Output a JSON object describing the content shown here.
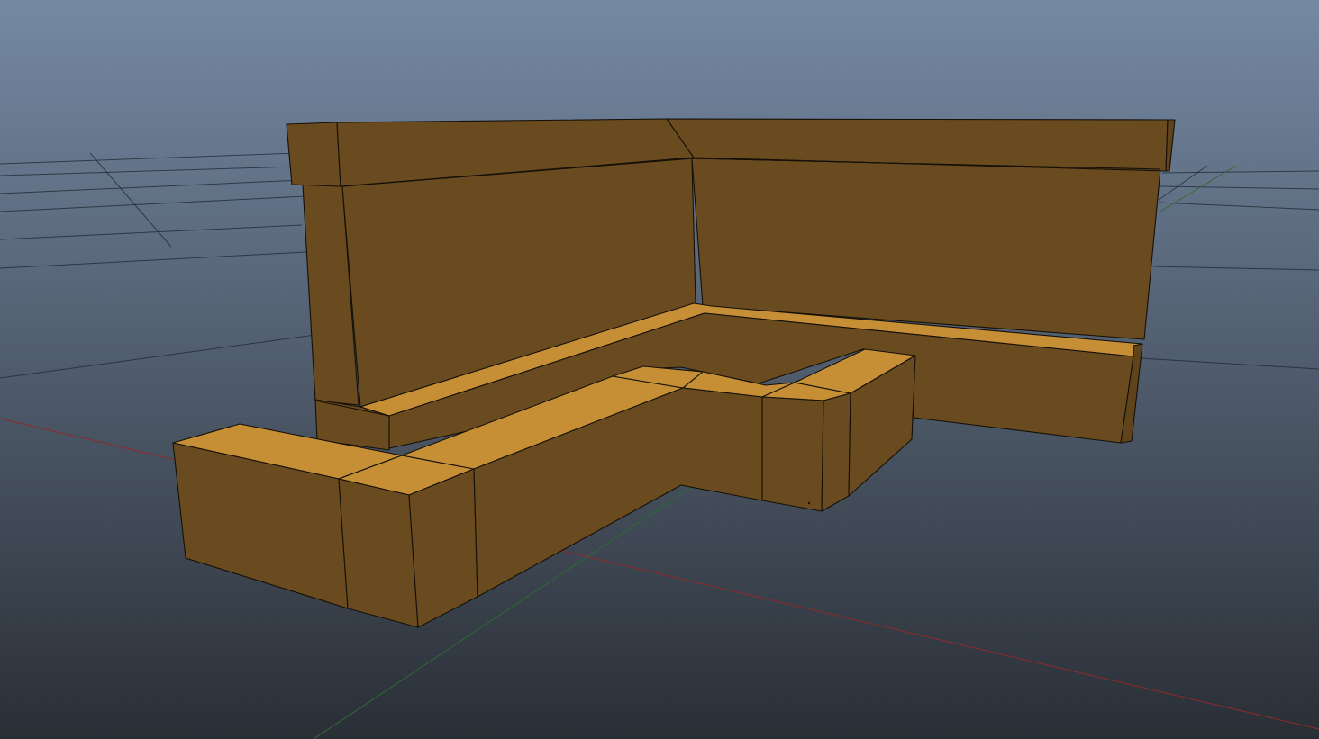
{
  "viewport": {
    "name": "3d-perspective-viewport",
    "background_top": "#7589a3",
    "background_bottom": "#2a2f36"
  },
  "colors": {
    "grid": "#1f2630",
    "axis_x": "#8e2a2a",
    "axis_z": "#2f6a35",
    "mesh_top": "#c78f35",
    "mesh_side": "#6a4b1f",
    "wireframe": "#141008"
  },
  "objects": [
    {
      "name": "corner-wall-back",
      "type": "mesh"
    },
    {
      "name": "corner-bench-back",
      "type": "mesh"
    },
    {
      "name": "corner-bench-front",
      "type": "mesh"
    }
  ]
}
